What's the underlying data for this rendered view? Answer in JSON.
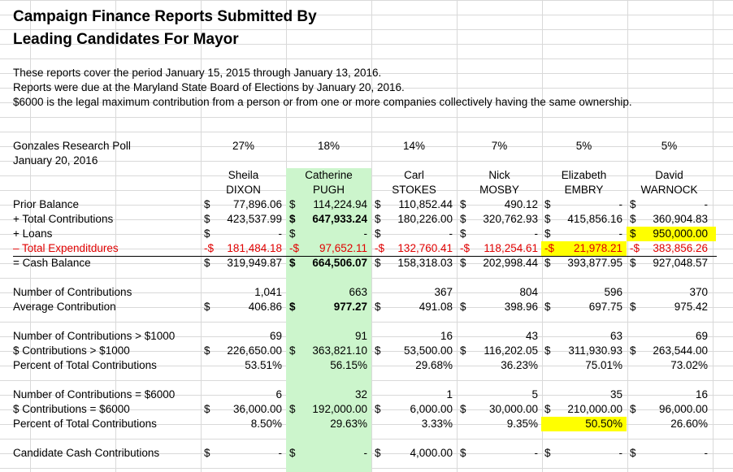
{
  "title": {
    "line1": "Campaign Finance Reports Submitted By",
    "line2": "Leading Candidates For Mayor"
  },
  "notes": [
    "These reports cover the period January 15, 2015 through January 13, 2016.",
    "Reports were due at the Maryland State Board of Elections by January 20, 2016.",
    "$6000 is the legal maximum contribution from a person or from one or more companies collectively having the same ownership."
  ],
  "poll": {
    "name": "Gonzales Research Poll",
    "date": "January 20, 2016"
  },
  "candidates": [
    {
      "first": "Sheila",
      "last": "DIXON",
      "poll": "27%"
    },
    {
      "first": "Catherine",
      "last": "PUGH",
      "poll": "18%"
    },
    {
      "first": "Carl",
      "last": "STOKES",
      "poll": "14%"
    },
    {
      "first": "Nick",
      "last": "MOSBY",
      "poll": "7%"
    },
    {
      "first": "Elizabeth",
      "last": "EMBRY",
      "poll": "5%"
    },
    {
      "first": "David",
      "last": "WARNOCK",
      "poll": "5%"
    }
  ],
  "rows": {
    "prior": {
      "label": "Prior Balance",
      "values": [
        [
          "$",
          " 77,896.06"
        ],
        [
          "$",
          " 114,224.94"
        ],
        [
          "$",
          " 110,852.44"
        ],
        [
          "$",
          "490.12"
        ],
        [
          "$",
          "-"
        ],
        [
          "$",
          "-"
        ]
      ]
    },
    "contrib": {
      "label": "+ Total Contributions",
      "values": [
        [
          "$",
          "423,537.99"
        ],
        [
          "$",
          " 647,933.24"
        ],
        [
          "$",
          " 180,226.00"
        ],
        [
          "$",
          "320,762.93"
        ],
        [
          "$",
          "415,856.16"
        ],
        [
          "$",
          "360,904.83"
        ]
      ]
    },
    "loans": {
      "label": "+ Loans",
      "values": [
        [
          "$",
          "-"
        ],
        [
          "$",
          "-"
        ],
        [
          "$",
          "-"
        ],
        [
          "$",
          "-"
        ],
        [
          "$",
          "-"
        ],
        [
          "$",
          "950,000.00"
        ]
      ]
    },
    "expend": {
      "label": "– Total Expenditdures",
      "values": [
        [
          "-$",
          " 181,484.18"
        ],
        [
          "-$",
          "97,652.11"
        ],
        [
          "-$",
          " 132,760.41"
        ],
        [
          "-$",
          " 118,254.61"
        ],
        [
          "-$",
          "21,978.21"
        ],
        [
          "-$",
          "383,856.26"
        ]
      ]
    },
    "cash": {
      "label": "= Cash Balance",
      "values": [
        [
          "$",
          "319,949.87"
        ],
        [
          "$",
          " 664,506.07"
        ],
        [
          "$",
          " 158,318.03"
        ],
        [
          "$",
          "202,998.44"
        ],
        [
          "$",
          "393,877.95"
        ],
        [
          "$",
          "927,048.57"
        ]
      ]
    },
    "num_contrib": {
      "label": "Number of Contributions",
      "values": [
        "1,041",
        "663",
        "367",
        "804",
        "596",
        "370"
      ]
    },
    "avg_contrib": {
      "label": "Average Contribution",
      "values": [
        [
          "$",
          "406.86"
        ],
        [
          "$",
          "977.27"
        ],
        [
          "$",
          "491.08"
        ],
        [
          "$",
          "398.96"
        ],
        [
          "$",
          "697.75"
        ],
        [
          "$",
          "975.42"
        ]
      ]
    },
    "num_1000": {
      "label": "Number of Contributions > $1000",
      "values": [
        "69",
        "91",
        "16",
        "43",
        "63",
        "69"
      ]
    },
    "amt_1000": {
      "label": "$ Contributions > $1000",
      "values": [
        [
          "$",
          "226,650.00"
        ],
        [
          "$",
          "363,821.10"
        ],
        [
          "$",
          " 53,500.00"
        ],
        [
          "$",
          "116,202.05"
        ],
        [
          "$",
          "311,930.93"
        ],
        [
          "$",
          "263,544.00"
        ]
      ]
    },
    "pct_1000": {
      "label": "Percent of Total Contributions",
      "values": [
        "53.51%",
        "56.15%",
        "29.68%",
        "36.23%",
        "75.01%",
        "73.02%"
      ]
    },
    "num_6000": {
      "label": "Number of Contributions = $6000",
      "values": [
        "6",
        "32",
        "1",
        "5",
        "35",
        "16"
      ]
    },
    "amt_6000": {
      "label": "$ Contributions = $6000",
      "values": [
        [
          "$",
          " 36,000.00"
        ],
        [
          "$",
          " 192,000.00"
        ],
        [
          "$",
          "6,000.00"
        ],
        [
          "$",
          " 30,000.00"
        ],
        [
          "$",
          "210,000.00"
        ],
        [
          "$",
          "96,000.00"
        ]
      ]
    },
    "pct_6000": {
      "label": "Percent of Total Contributions",
      "values": [
        "8.50%",
        "29.63%",
        "3.33%",
        "9.35%",
        "50.50%",
        "26.60%"
      ]
    },
    "cash_contrib": {
      "label": "Candidate Cash Contributions",
      "values": [
        [
          "$",
          "-"
        ],
        [
          "$",
          "-"
        ],
        [
          "$",
          "4,000.00"
        ],
        [
          "$",
          "-"
        ],
        [
          "$",
          "-"
        ],
        [
          "$",
          "-"
        ]
      ]
    }
  },
  "colors": {
    "highlight_green": "#ccf5cc",
    "highlight_yellow": "#ffff00",
    "negative_red": "#e00000",
    "grid": "#d9d9d9"
  }
}
